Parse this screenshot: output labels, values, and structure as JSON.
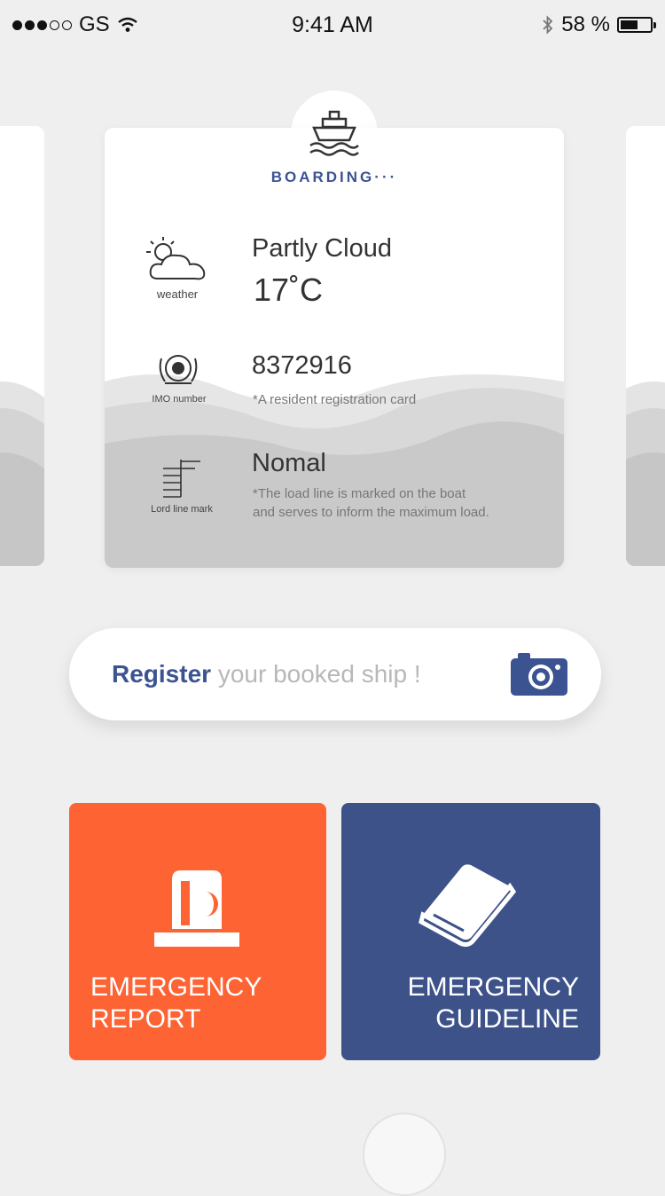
{
  "status_bar": {
    "carrier": "GS",
    "time": "9:41 AM",
    "battery": "58 %",
    "battery_level": 0.58
  },
  "card": {
    "badge": "BOARDING",
    "badge_suffix": "···",
    "weather": {
      "caption": "weather",
      "title": "Partly Cloud",
      "value": "17˚C"
    },
    "imo": {
      "caption": "IMO number",
      "title": "8372916",
      "note": "*A resident registration card"
    },
    "load_line": {
      "caption": "Lord line mark",
      "title": "Nomal",
      "note_line1": "*The load line is marked on the boat",
      "note_line2": "and serves to inform the maximum load."
    }
  },
  "register": {
    "strong": "Register",
    "rest": " your booked ship !"
  },
  "tiles": {
    "report_line1": "EMERGENCY",
    "report_line2": "REPORT",
    "guide_line1": "EMERGENCY",
    "guide_line2": "GUIDELINE"
  },
  "colors": {
    "background": "#efeff0",
    "brand_blue": "#3b5391",
    "report_orange": "#fe6333",
    "guide_navy": "#3d5289"
  },
  "icons": [
    "signal-dots-icon",
    "wifi-icon",
    "bluetooth-icon",
    "battery-icon",
    "ship-icon",
    "weather-icon",
    "imo-emblem-icon",
    "load-line-icon",
    "camera-icon",
    "siren-icon",
    "book-icon"
  ]
}
